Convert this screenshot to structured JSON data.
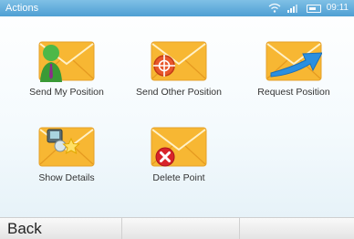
{
  "title": "Actions",
  "status": {
    "time": "09:11",
    "wifi_icon": "wifi-icon",
    "signal_icon": "signal-icon",
    "battery_icon": "battery-icon"
  },
  "tiles": [
    {
      "label": "Send My Position",
      "icon": "send-my-position-icon"
    },
    {
      "label": "Send Other Position",
      "icon": "send-other-position-icon"
    },
    {
      "label": "Request Position",
      "icon": "request-position-icon"
    },
    {
      "label": "Show Details",
      "icon": "show-details-icon"
    },
    {
      "label": "Delete Point",
      "icon": "delete-point-icon"
    }
  ],
  "softkeys": {
    "left": "Back",
    "middle": "",
    "right": ""
  },
  "colors": {
    "titlebar": "#5aa8d9",
    "envelope": "#f7b733",
    "envelope_dark": "#e08f12",
    "arrow": "#2a8fe0",
    "delete": "#d8232a",
    "person": "#4db848"
  }
}
